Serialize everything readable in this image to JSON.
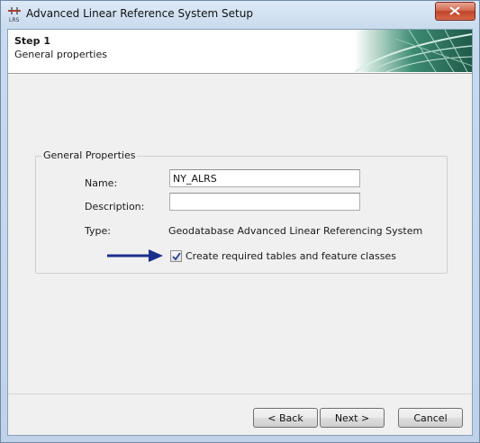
{
  "window": {
    "title": "Advanced Linear Reference System Setup",
    "app_icon": "lrs-icon"
  },
  "header": {
    "step_title": "Step 1",
    "step_subtitle": "General properties"
  },
  "general_properties": {
    "legend": "General Properties",
    "name_label": "Name:",
    "name_value": "NY_ALRS",
    "description_label": "Description:",
    "description_value": "",
    "type_label": "Type:",
    "type_value": "Geodatabase Advanced Linear Referencing System",
    "create_tables_label": "Create required tables and feature classes",
    "create_tables_checked": true
  },
  "footer": {
    "back_label": "< Back",
    "next_label": "Next >",
    "cancel_label": "Cancel"
  },
  "colors": {
    "arrow": "#1a2f8c",
    "close_button": "#c94a33",
    "header_graphic": "#2f7a63"
  }
}
